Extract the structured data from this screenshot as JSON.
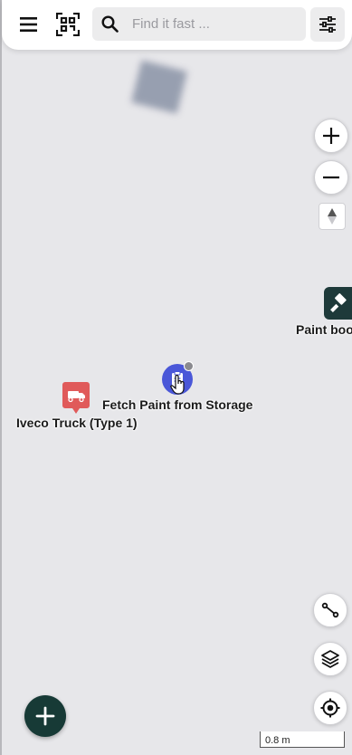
{
  "search": {
    "placeholder": "Find it fast ..."
  },
  "map": {
    "pois": [
      {
        "label": "Paint boo",
        "icon": "hammer-icon"
      },
      {
        "label": "Fetch Paint from Storage",
        "icon": "clipboard-icon"
      },
      {
        "label": "Iveco Truck (Type 1)",
        "icon": "truck-icon"
      }
    ],
    "scale_label": "0.8 m"
  },
  "colors": {
    "task_marker": "#4a57d8",
    "truck_marker": "#e05a5a",
    "paint_marker": "#1e3a3a",
    "fab": "#173a36"
  }
}
